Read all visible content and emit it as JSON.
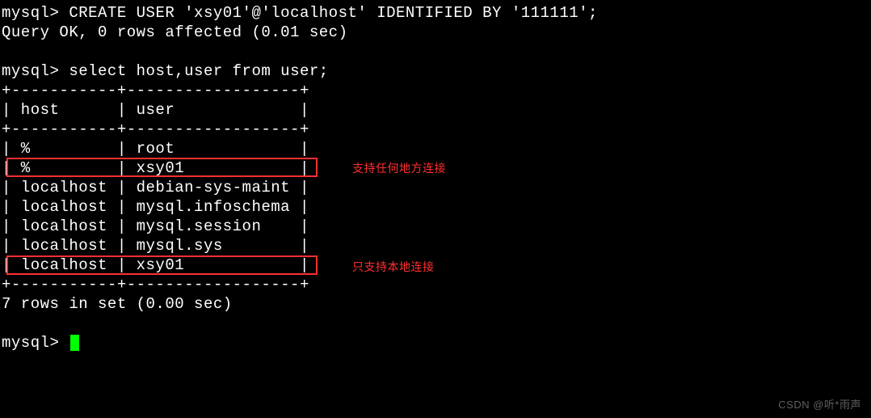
{
  "terminal": {
    "prompt": "mysql> ",
    "cmd1": "CREATE USER 'xsy01'@'localhost' IDENTIFIED BY '111111';",
    "result1": "Query OK, 0 rows affected (0.01 sec)",
    "cmd2": "select host,user from user;",
    "table": {
      "border_top": "+-----------+------------------+",
      "header": "| host      | user             |",
      "border_mid": "+-----------+------------------+",
      "rows": [
        "| %         | root             |",
        "| %         | xsy01            |",
        "| localhost | debian-sys-maint |",
        "| localhost | mysql.infoschema |",
        "| localhost | mysql.session    |",
        "| localhost | mysql.sys        |",
        "| localhost | xsy01            |"
      ],
      "border_bot": "+-----------+------------------+",
      "data": [
        {
          "host": "%",
          "user": "root"
        },
        {
          "host": "%",
          "user": "xsy01"
        },
        {
          "host": "localhost",
          "user": "debian-sys-maint"
        },
        {
          "host": "localhost",
          "user": "mysql.infoschema"
        },
        {
          "host": "localhost",
          "user": "mysql.session"
        },
        {
          "host": "localhost",
          "user": "mysql.sys"
        },
        {
          "host": "localhost",
          "user": "xsy01"
        }
      ]
    },
    "result2": "7 rows in set (0.00 sec)",
    "annotations": {
      "any_connect": "支持任何地方连接",
      "local_connect": "只支持本地连接"
    },
    "watermark": "CSDN @听*雨声"
  }
}
